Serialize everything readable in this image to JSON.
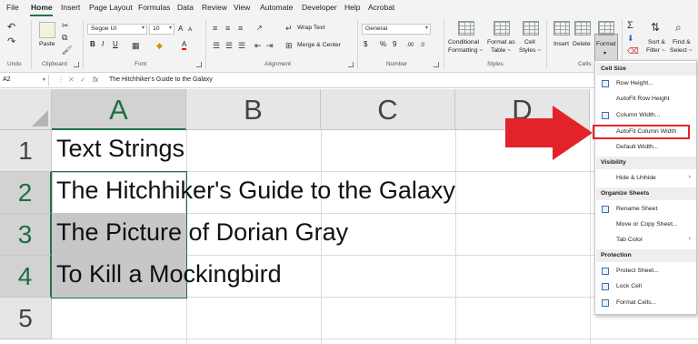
{
  "menu": {
    "tabs": [
      {
        "label": "File"
      },
      {
        "label": "Home",
        "active": true
      },
      {
        "label": "Insert"
      },
      {
        "label": "Page Layout"
      },
      {
        "label": "Formulas"
      },
      {
        "label": "Data"
      },
      {
        "label": "Review"
      },
      {
        "label": "View"
      },
      {
        "label": "Automate"
      },
      {
        "label": "Developer"
      },
      {
        "label": "Help"
      },
      {
        "label": "Acrobat"
      }
    ]
  },
  "ribbon": {
    "undo_label": "Undo",
    "clipboard": {
      "paste": "Paste",
      "group": "Clipboard"
    },
    "font": {
      "name": "Segoe UI",
      "size": "10",
      "bold": "B",
      "italic": "I",
      "underline": "U",
      "grow": "A",
      "shrink": "A",
      "color_letter": "A",
      "group": "Font"
    },
    "alignment": {
      "wrap": "Wrap Text",
      "merge": "Merge & Center",
      "group": "Alignment"
    },
    "number": {
      "format": "General",
      "currency": "$",
      "percent": "%",
      "comma": "9",
      "dec_inc": ".00",
      "dec_dec": ".0",
      "group": "Number"
    },
    "styles": {
      "conditional": "Conditional",
      "conditional2": "Formatting ~",
      "format_as": "Format as",
      "format_as2": "Table ~",
      "cell_styles": "Cell",
      "cell_styles2": "Styles ~",
      "group": "Styles"
    },
    "cells": {
      "insert": "Insert",
      "delete": "Delete",
      "format": "Format",
      "group": "Cells"
    },
    "editing": {
      "sort": "Sort &",
      "sort2": "Filter ~",
      "find": "Find &",
      "find2": "Select ~"
    }
  },
  "formula_bar": {
    "name_box": "A2",
    "cancel": "✕",
    "enter": "✓",
    "fx": "fx",
    "content": "The Hitchhiker's Guide to the Galaxy"
  },
  "sheet": {
    "columns": [
      "A",
      "B",
      "C",
      "D"
    ],
    "rows": [
      "1",
      "2",
      "3",
      "4",
      "5"
    ],
    "cells": [
      "Text Strings",
      "The Hitchhiker's Guide to the Galaxy",
      "The Picture of Dorian Gray",
      "To Kill a Mockingbird"
    ]
  },
  "dropdown": {
    "sections": {
      "cell_size": "Cell Size",
      "visibility": "Visibility",
      "organize": "Organize Sheets",
      "protection": "Protection"
    },
    "items": {
      "row_height": "Row Height...",
      "autofit_row": "AutoFit Row Height",
      "column_width": "Column Width...",
      "autofit_column": "AutoFit Column Width",
      "default_width": "Default Width...",
      "hide_unhide": "Hide & Unhide",
      "rename": "Rename Sheet",
      "move_copy": "Move or Copy Sheet...",
      "tab_color": "Tab Color",
      "protect": "Protect Sheet...",
      "lock": "Lock Cell",
      "format_cells": "Format Cells..."
    },
    "submenu_arrow": "›"
  },
  "colors": {
    "accent": "#217346",
    "highlight_red": "#e3232a"
  }
}
